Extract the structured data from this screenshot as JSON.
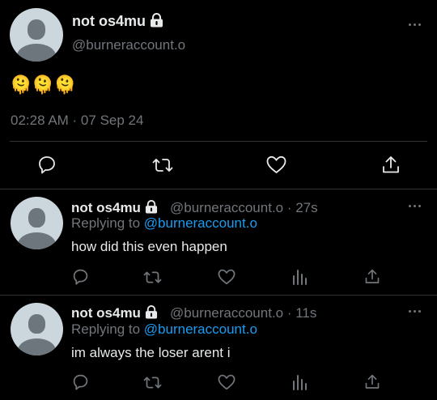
{
  "main_tweet": {
    "display_name": "not os4mu",
    "handle": "@burneraccount.o",
    "text": "🫠🫠🫠",
    "timestamp": "02:28 AM · 07 Sep 24"
  },
  "replies": [
    {
      "display_name": "not os4mu",
      "handle_time": "@burneraccount.o · 27s",
      "replying_prefix": "Replying to ",
      "replying_handle": "@burneraccount.o",
      "text": "how did this even happen"
    },
    {
      "display_name": "not os4mu",
      "handle_time": "@burneraccount.o · 11s",
      "replying_prefix": "Replying to ",
      "replying_handle": "@burneraccount.o",
      "text": "im always the loser arent i"
    }
  ],
  "icons": {
    "lock": "lock-icon",
    "more": "more-icon",
    "reply": "reply-icon",
    "retweet": "retweet-icon",
    "like": "like-icon",
    "analytics": "analytics-icon",
    "share": "share-icon"
  },
  "colors": {
    "background": "#000000",
    "text": "#e7e9ea",
    "secondary": "#71767b",
    "link": "#1d9bf0",
    "divider": "#2f3336",
    "avatar_bg": "#ccd6dd",
    "avatar_fg": "#6e767d"
  }
}
